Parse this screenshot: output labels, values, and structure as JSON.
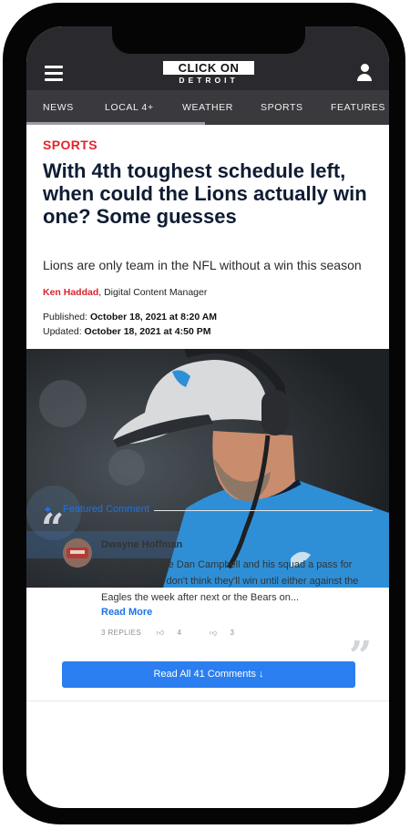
{
  "header": {
    "logo_top": "CLICK ON",
    "logo_bottom": "DETROIT",
    "menu_icon": "hamburger-menu-icon",
    "account_icon": "user-account-icon"
  },
  "nav": {
    "items": [
      "NEWS",
      "LOCAL 4+",
      "WEATHER",
      "SPORTS",
      "FEATURES"
    ]
  },
  "article": {
    "section": "SPORTS",
    "headline": "With 4th toughest schedule left, when could the Lions actually win one? Some guesses",
    "subhead": "Lions are only team in the NFL without a win this season",
    "author": "Ken Haddad",
    "author_role": ", Digital Content Manager",
    "published_label": "Published: ",
    "published": "October 18, 2021 at 8:20 AM",
    "updated_label": "Updated: ",
    "updated": "October 18, 2021 at 4:50 PM"
  },
  "comments": {
    "featured_label": "Featured Comment",
    "commenter": "Dwayne Hoffman",
    "text": "I'm going to give Dan Campbell and his squad a pass for this season, (I don't think they'll win until either against the Eagles the week after next or the Bears on...",
    "read_more": "Read More",
    "replies": "3 REPLIES",
    "likes": "4",
    "dislikes": "3",
    "read_all": "Read All 41 Comments ↓"
  },
  "colors": {
    "header_bg": "#2a2a2e",
    "section_red": "#e1252e",
    "headline_navy": "#0f1c33",
    "link_blue": "#1a73e8",
    "button_blue": "#2b7ef0"
  }
}
